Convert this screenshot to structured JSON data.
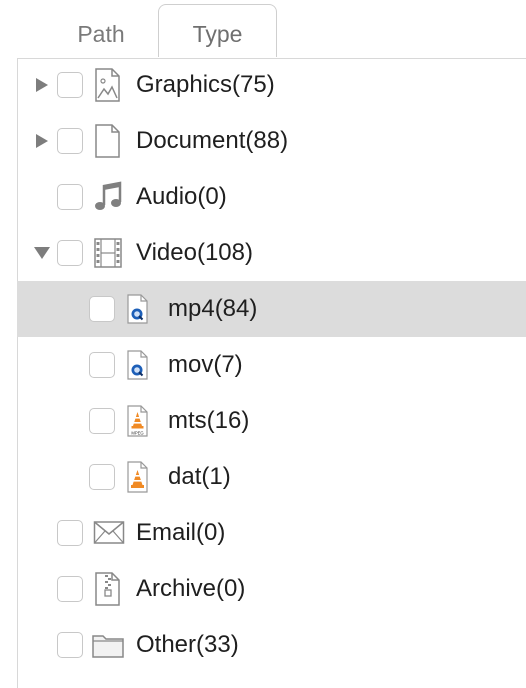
{
  "tabs": [
    {
      "label": "Path"
    },
    {
      "label": "Type"
    }
  ],
  "tree": {
    "graphics": "Graphics(75)",
    "document": "Document(88)",
    "audio": "Audio(0)",
    "video": "Video(108)",
    "mp4": "mp4(84)",
    "mov": "mov(7)",
    "mts": "mts(16)",
    "dat": "dat(1)",
    "email": "Email(0)",
    "archive": "Archive(0)",
    "other": "Other(33)"
  },
  "icons": {
    "graphics": "image-file-icon",
    "document": "document-file-icon",
    "audio": "music-note-icon",
    "video": "film-strip-icon",
    "mp4": "quicktime-file-icon",
    "mov": "quicktime-file-icon",
    "mts": "vlc-mpeg-file-icon",
    "dat": "vlc-file-icon",
    "email": "envelope-icon",
    "archive": "zip-archive-icon",
    "other": "folder-icon"
  },
  "colors": {
    "selection": "#dcdcdc",
    "vlc_orange": "#f08a24",
    "quicktime_blue": "#1d5fb8"
  }
}
